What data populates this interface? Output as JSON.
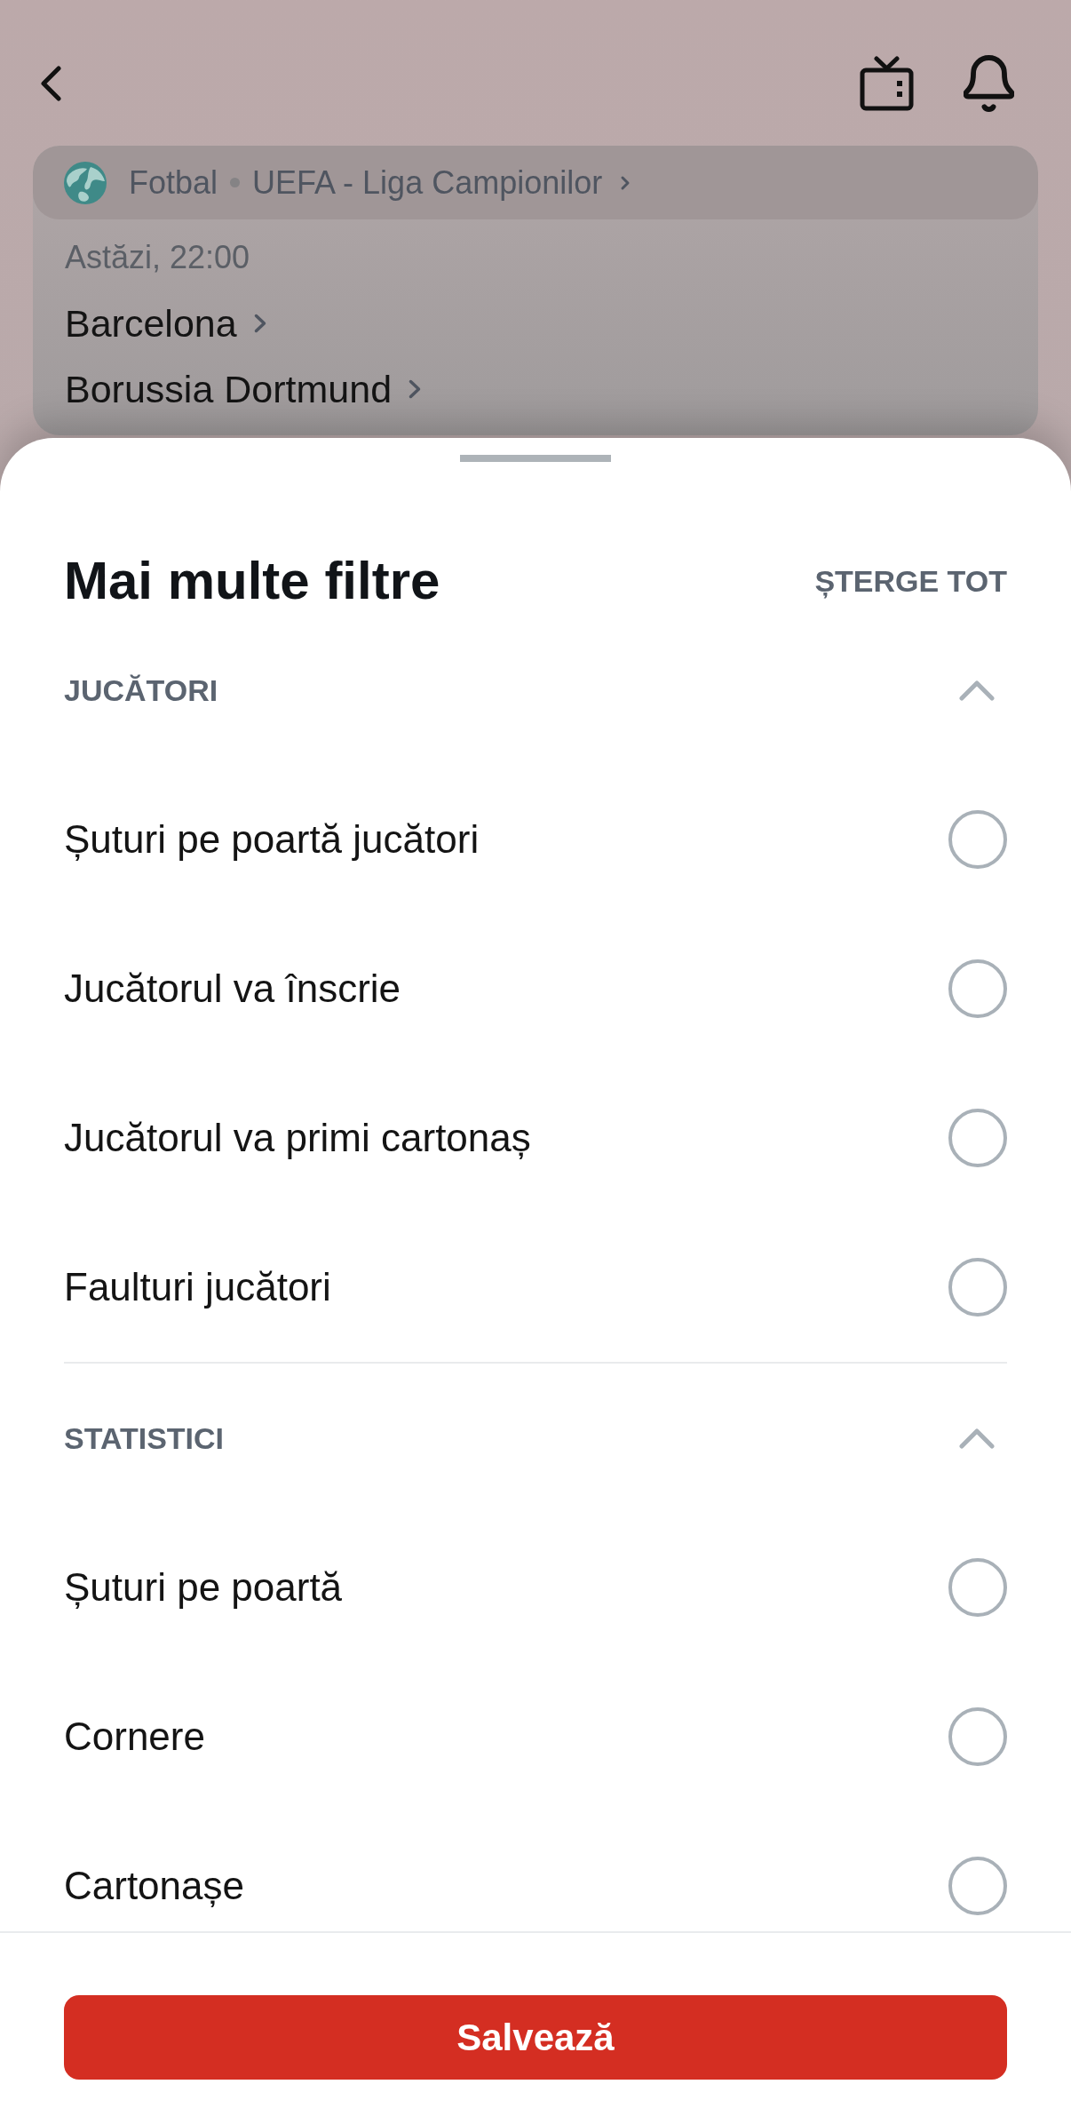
{
  "match": {
    "sport": "Fotbal",
    "competition": "UEFA - Liga Campionilor",
    "time": "Astăzi, 22:00",
    "teams": [
      "Barcelona",
      "Borussia Dortmund"
    ]
  },
  "sheet": {
    "title": "Mai multe filtre",
    "clear_all": "ȘTERGE TOT",
    "sections": [
      {
        "title": "JUCĂTORI",
        "expanded": true,
        "options": [
          {
            "label": "Șuturi pe poartă jucători",
            "selected": false
          },
          {
            "label": "Jucătorul va înscrie",
            "selected": false
          },
          {
            "label": "Jucătorul va primi cartonaș",
            "selected": false
          },
          {
            "label": "Faulturi jucători",
            "selected": false
          }
        ]
      },
      {
        "title": "STATISTICI",
        "expanded": true,
        "options": [
          {
            "label": "Șuturi pe poartă",
            "selected": false
          },
          {
            "label": "Cornere",
            "selected": false
          },
          {
            "label": "Cartonașe",
            "selected": false
          }
        ]
      }
    ],
    "save_button": "Salvează"
  }
}
